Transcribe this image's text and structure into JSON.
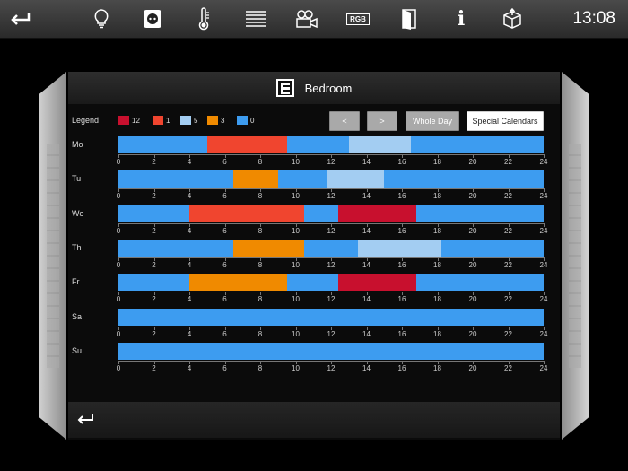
{
  "topbar": {
    "icons": [
      "return-icon",
      "lightbulb-icon",
      "power-socket-icon",
      "thermometer-icon",
      "blinds-icon",
      "camera-icon",
      "rgb-icon",
      "door-icon",
      "info-icon",
      "package-icon"
    ],
    "rgb_text": "RGB",
    "info_text": "i",
    "clock": "13:08"
  },
  "room": {
    "title": "Bedroom"
  },
  "legend": {
    "label": "Legend",
    "items": [
      {
        "label": "12",
        "color": "#c8102e"
      },
      {
        "label": "1",
        "color": "#f0452f"
      },
      {
        "label": "5",
        "color": "#a3cdf2"
      },
      {
        "label": "3",
        "color": "#f08a00"
      },
      {
        "label": "0",
        "color": "#3d9cf0"
      }
    ]
  },
  "controls": {
    "prev": "<",
    "next": ">",
    "whole_day": "Whole Day",
    "special_calendars": "Special Calendars"
  },
  "axis": {
    "ticks": [
      "0",
      "2",
      "4",
      "6",
      "8",
      "10",
      "12",
      "14",
      "16",
      "18",
      "20",
      "22",
      "24"
    ],
    "min": 0,
    "max": 24
  },
  "schedule": [
    {
      "day": "Mo",
      "segments": [
        [
          0,
          5,
          "0"
        ],
        [
          5,
          9.5,
          "1"
        ],
        [
          9.5,
          13,
          "0"
        ],
        [
          13,
          16.5,
          "5"
        ],
        [
          16.5,
          24,
          "0"
        ]
      ]
    },
    {
      "day": "Tu",
      "segments": [
        [
          0,
          6.5,
          "0"
        ],
        [
          6.5,
          9,
          "3"
        ],
        [
          9,
          11.75,
          "0"
        ],
        [
          11.75,
          15,
          "5"
        ],
        [
          15,
          24,
          "0"
        ]
      ]
    },
    {
      "day": "We",
      "segments": [
        [
          0,
          4,
          "0"
        ],
        [
          4,
          10.5,
          "1"
        ],
        [
          10.5,
          12.4,
          "0"
        ],
        [
          12.4,
          16.8,
          "12"
        ],
        [
          16.8,
          24,
          "0"
        ]
      ]
    },
    {
      "day": "Th",
      "segments": [
        [
          0,
          6.5,
          "0"
        ],
        [
          6.5,
          10.5,
          "3"
        ],
        [
          10.5,
          13.5,
          "0"
        ],
        [
          13.5,
          18.25,
          "5"
        ],
        [
          18.25,
          24,
          "0"
        ]
      ]
    },
    {
      "day": "Fr",
      "segments": [
        [
          0,
          4,
          "0"
        ],
        [
          4,
          9.5,
          "3"
        ],
        [
          9.5,
          12.4,
          "0"
        ],
        [
          12.4,
          16.8,
          "12"
        ],
        [
          16.8,
          24,
          "0"
        ]
      ]
    },
    {
      "day": "Sa",
      "segments": [
        [
          0,
          24,
          "0"
        ]
      ]
    },
    {
      "day": "Su",
      "segments": [
        [
          0,
          24,
          "0"
        ]
      ]
    }
  ]
}
